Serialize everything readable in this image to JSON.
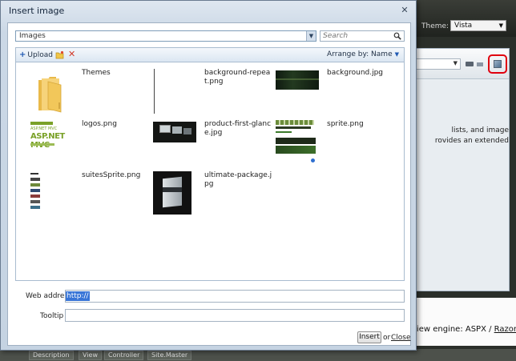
{
  "background": {
    "theme_label": "Theme:",
    "theme_value": "Vista",
    "editor_text": "lists, and image\nrovides an extended",
    "view_engine_prefix": "view engine: ASPX / ",
    "view_engine_link": "Razor",
    "tabs": [
      "Description",
      "View",
      "Controller",
      "Site.Master"
    ]
  },
  "dialog": {
    "title": "Insert image",
    "close_glyph": "✕",
    "path": "Images",
    "search_placeholder": "Search",
    "toolbar": {
      "upload_label": "Upload",
      "arrange_label": "Arrange by: Name"
    },
    "files": [
      {
        "name": "Themes",
        "kind": "folder"
      },
      {
        "name": "background-repeat.png",
        "kind": "image"
      },
      {
        "name": "background.jpg",
        "kind": "image"
      },
      {
        "name": "logos.png",
        "kind": "image"
      },
      {
        "name": "product-first-glance.jpg",
        "kind": "image"
      },
      {
        "name": "sprite.png",
        "kind": "image"
      },
      {
        "name": "suitesSprite.png",
        "kind": "image"
      },
      {
        "name": "ultimate-package.jpg",
        "kind": "image"
      }
    ],
    "logo_thumb_text": {
      "line1": "ASP.NET MVC",
      "line2": "ASP.NET MVC"
    },
    "form": {
      "web_address_label": "Web address",
      "web_address_value": "http://",
      "tooltip_label": "Tooltip",
      "tooltip_value": ""
    },
    "actions": {
      "insert_label": "Insert",
      "or_text": "or",
      "close_label": "Close"
    }
  },
  "colors": {
    "accent_blue": "#1f59b3",
    "highlight_red": "#e0000e",
    "selection_blue": "#3875d7"
  }
}
